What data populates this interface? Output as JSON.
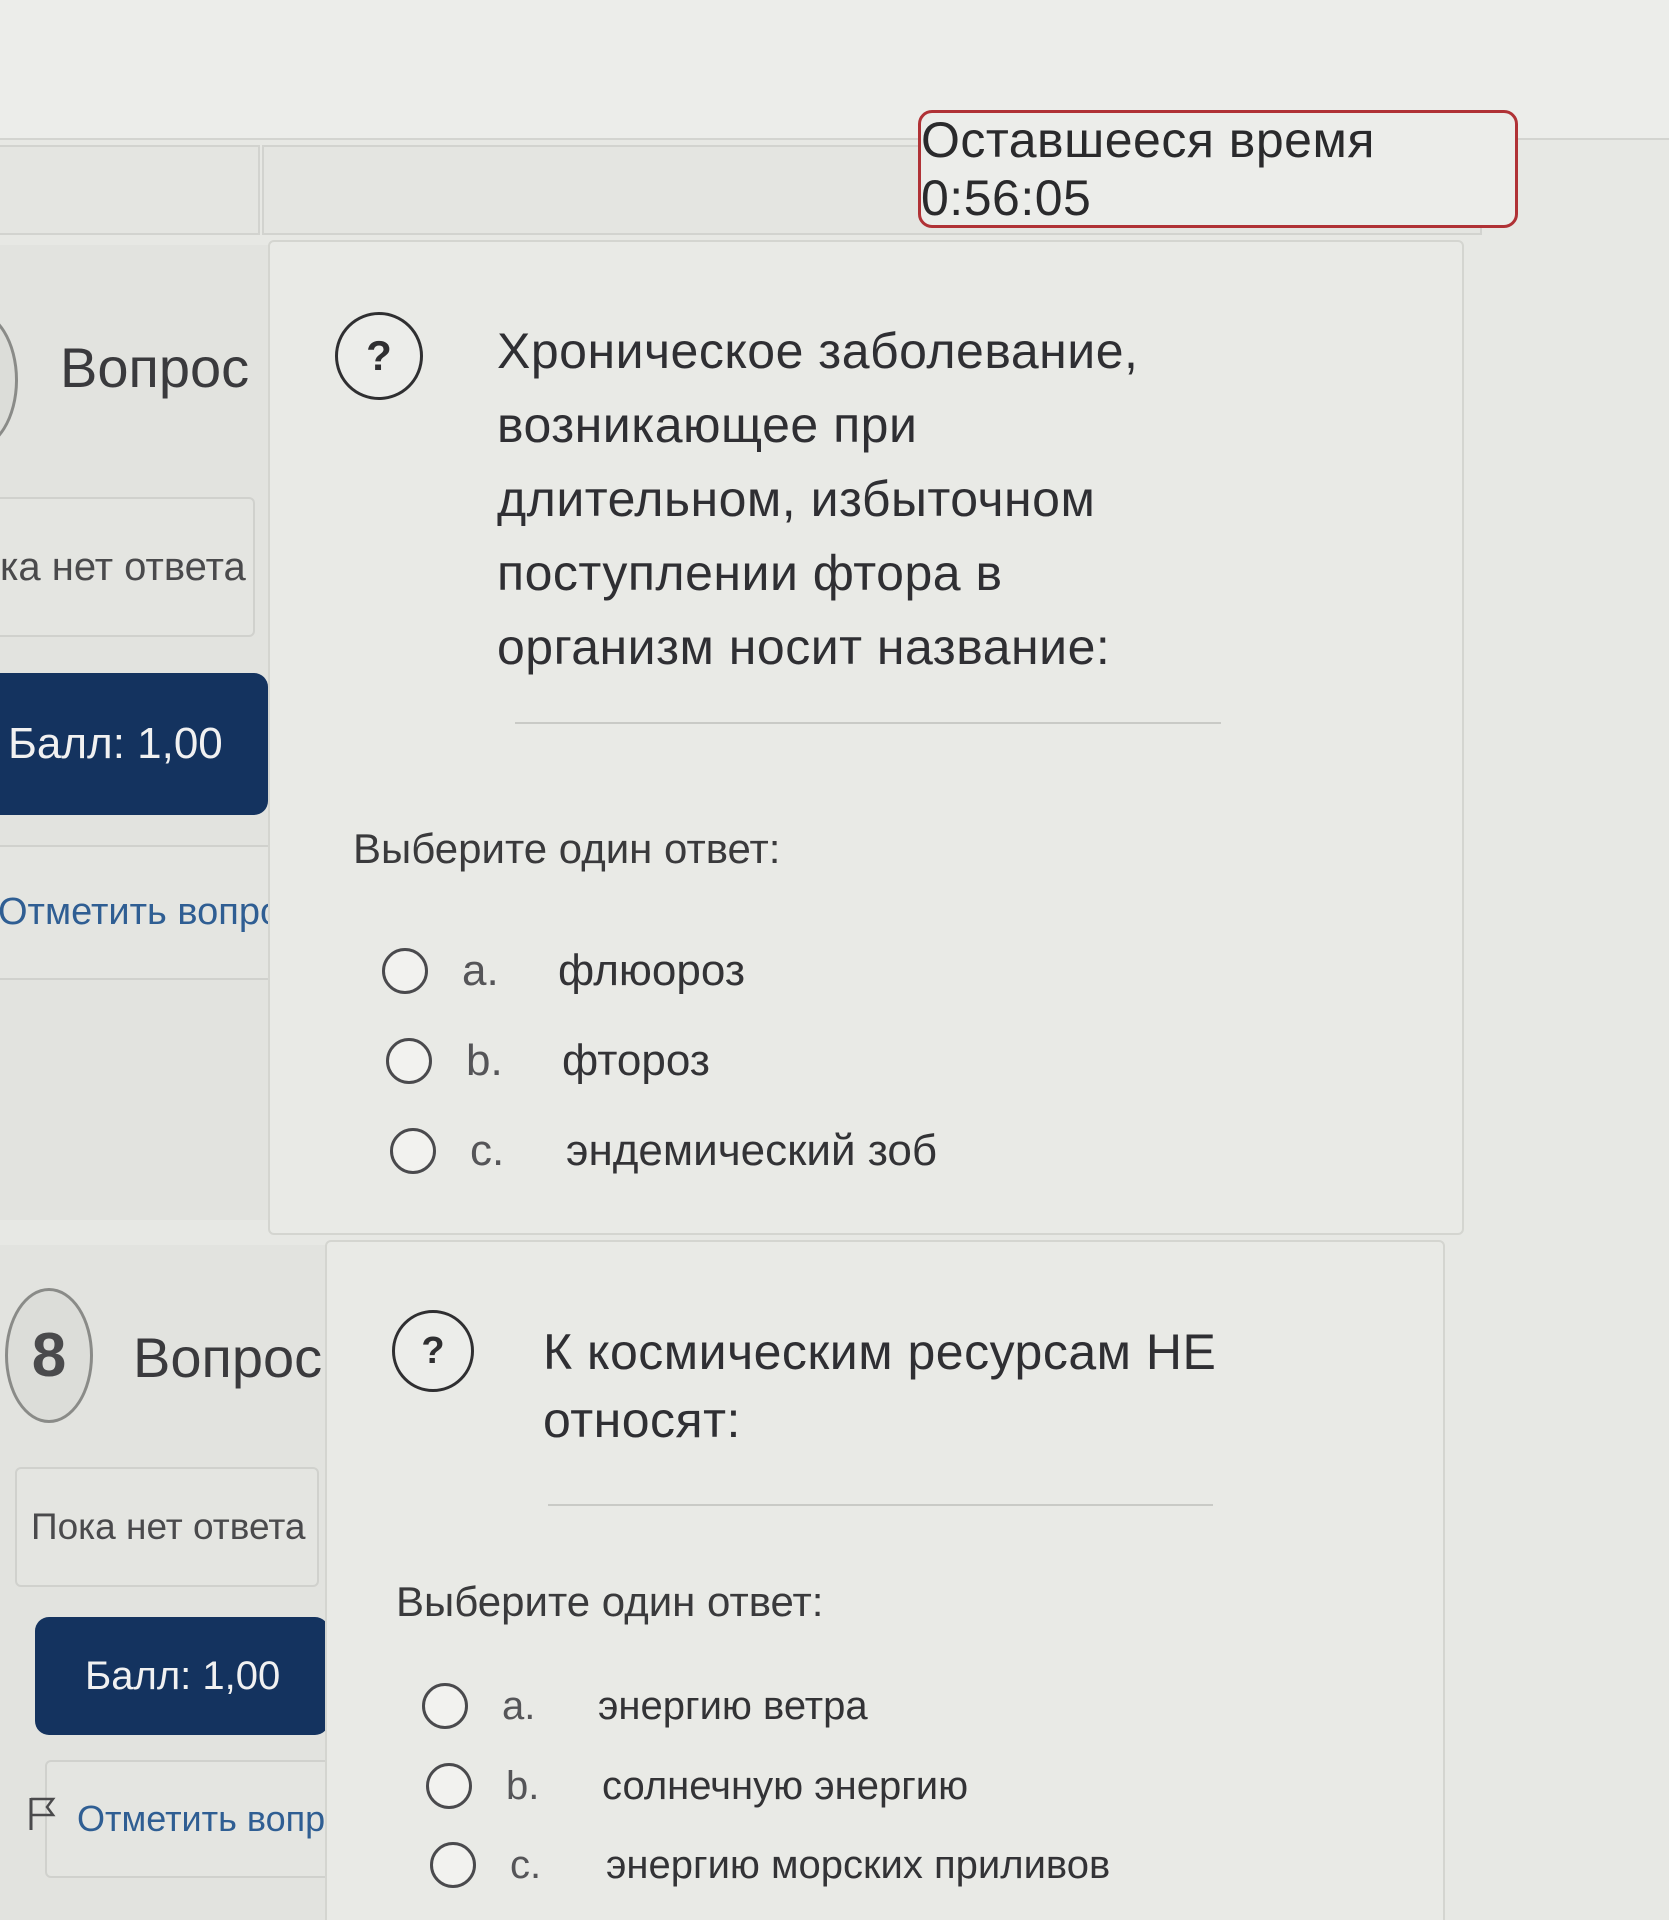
{
  "timer": {
    "text": "Оставшееся время 0:56:05"
  },
  "questions": [
    {
      "number": "",
      "word": "Вопрос",
      "state": "ка нет ответа",
      "grade": "Балл: 1,00",
      "flag": "Отметить вопрос",
      "help": "?",
      "text": [
        "Хроническое заболевание,",
        "возникающее при",
        "длительном, избыточном",
        "поступлении фтора в",
        "организм носит название:"
      ],
      "prompt": "Выберите один ответ:",
      "options": [
        {
          "letter": "a.",
          "label": "флюороз"
        },
        {
          "letter": "b.",
          "label": "фтороз"
        },
        {
          "letter": "c.",
          "label": "эндемический зоб"
        }
      ]
    },
    {
      "number": "8",
      "word": "Вопрос",
      "state": "Пока нет ответа",
      "grade": "Балл: 1,00",
      "flag": "Отметить вопрос",
      "help": "?",
      "text": [
        "К космическим ресурсам НЕ",
        "относят:"
      ],
      "prompt": "Выберите один ответ:",
      "options": [
        {
          "letter": "a.",
          "label": "энергию ветра"
        },
        {
          "letter": "b.",
          "label": "солнечную энергию"
        },
        {
          "letter": "c.",
          "label": "энергию морских приливов"
        }
      ]
    }
  ]
}
